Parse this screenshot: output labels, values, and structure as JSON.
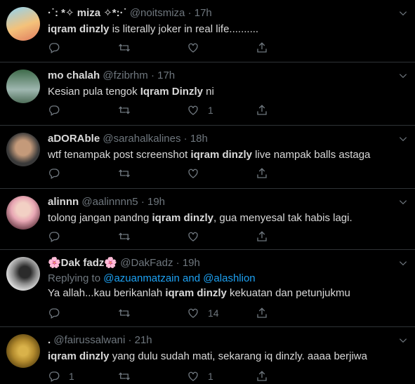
{
  "tweets": [
    {
      "name": "·˙: *✧ miza ✧*:·˙",
      "handle": "@noitsmiza",
      "time": "17h",
      "reply_prefix": "",
      "reply_mentions": "",
      "body_pre": "",
      "body_bold": "iqram dinzly",
      "body_post": " is literally joker in real life..........",
      "replies": "",
      "retweets": "",
      "likes": "",
      "avatar_colors": [
        "#f4c27a",
        "#e07b5f"
      ]
    },
    {
      "name": "mo chalah",
      "handle": "@fzibrhm",
      "time": "17h",
      "reply_prefix": "",
      "reply_mentions": "",
      "body_pre": "Kesian pula tengok ",
      "body_bold": "Iqram Dinzly",
      "body_post": " ni",
      "replies": "",
      "retweets": "",
      "likes": "1",
      "avatar_colors": [
        "#3e6b4a",
        "#9fb7b0"
      ]
    },
    {
      "name": "aDORAble",
      "handle": "@sarahalkalines",
      "time": "18h",
      "reply_prefix": "",
      "reply_mentions": "",
      "body_pre": "wtf tenampak post screenshot ",
      "body_bold": "iqram dinzly",
      "body_post": " live nampak balls astaga",
      "replies": "",
      "retweets": "",
      "likes": "",
      "avatar_colors": [
        "#3a3a3a",
        "#c49a7a"
      ]
    },
    {
      "name": "alinnn",
      "handle": "@aalinnnn5",
      "time": "19h",
      "reply_prefix": "",
      "reply_mentions": "",
      "body_pre": "tolong jangan pandng ",
      "body_bold": "iqram dinzly",
      "body_post": ", gua menyesal tak habis lagi.",
      "replies": "",
      "retweets": "",
      "likes": "",
      "avatar_colors": [
        "#e8a7b4",
        "#7a4a55"
      ]
    },
    {
      "name": "🌸Dak fadz🌸",
      "handle": "@DakFadz",
      "time": "19h",
      "reply_prefix": "Replying to ",
      "reply_mentions": "@azuanmatzain and @alashlion",
      "body_pre": "Ya allah...kau berikanlah ",
      "body_bold": "iqram dinzly",
      "body_post": " kekuatan dan petunjukmu",
      "replies": "",
      "retweets": "",
      "likes": "14",
      "avatar_colors": [
        "#d9d9d9",
        "#2b2b2b"
      ]
    },
    {
      "name": ".",
      "handle": "@fairussalwani",
      "time": "21h",
      "reply_prefix": "",
      "reply_mentions": "",
      "body_pre": "",
      "body_bold": "iqram dinzly",
      "body_post": " yang dulu sudah mati, sekarang iq dinzly. aaaa berjiwa",
      "replies": "1",
      "retweets": "",
      "likes": "1",
      "avatar_colors": [
        "#b38b2e",
        "#5a4310"
      ]
    }
  ],
  "icons": {
    "reply": "reply-icon",
    "retweet": "retweet-icon",
    "like": "like-icon",
    "share": "share-icon",
    "menu": "chevron-down-icon"
  },
  "colors": {
    "background": "#000000",
    "text": "#d9d9d9",
    "muted": "#6e767d",
    "link": "#1da1f2",
    "divider": "#2f3336"
  }
}
